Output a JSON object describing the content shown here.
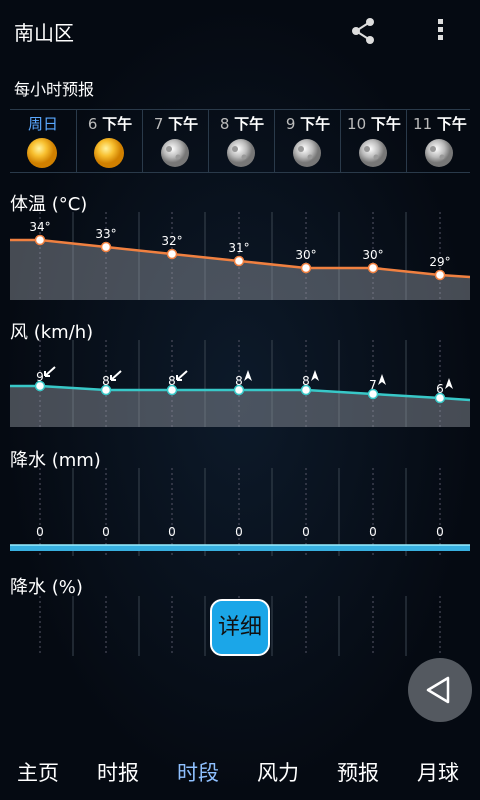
{
  "app": {
    "title": "南山区"
  },
  "icons": {
    "share": "share-icon",
    "more": "more-vert-icon",
    "back": "back-triangle-icon"
  },
  "hourly": {
    "heading": "每小时预报",
    "columns": [
      {
        "num": "",
        "suffix": "周日",
        "today": true,
        "icon": "sun-icon"
      },
      {
        "num": "6",
        "suffix": "下午",
        "today": false,
        "icon": "sun-icon"
      },
      {
        "num": "7",
        "suffix": "下午",
        "today": false,
        "icon": "moon-icon"
      },
      {
        "num": "8",
        "suffix": "下午",
        "today": false,
        "icon": "moon-icon"
      },
      {
        "num": "9",
        "suffix": "下午",
        "today": false,
        "icon": "moon-icon"
      },
      {
        "num": "10",
        "suffix": "下午",
        "today": false,
        "icon": "moon-icon"
      },
      {
        "num": "11",
        "suffix": "下午",
        "today": false,
        "icon": "moon-icon"
      }
    ]
  },
  "sections": {
    "temp": {
      "title": "体温 (°C)"
    },
    "wind": {
      "title": "风 (km/h)"
    },
    "precip_mm": {
      "title": "降水 (mm)"
    },
    "precip_pct": {
      "title": "降水 (%)"
    }
  },
  "chart_data": [
    {
      "type": "area",
      "name": "temp",
      "unit": "°",
      "values": [
        34,
        33,
        32,
        31,
        30,
        30,
        29
      ],
      "color": "#f08040"
    },
    {
      "type": "area",
      "name": "wind",
      "values": [
        9,
        8,
        8,
        8,
        8,
        7,
        6
      ],
      "color": "#38c8c8"
    },
    {
      "type": "area",
      "name": "precip_mm",
      "values": [
        0,
        0,
        0,
        0,
        0,
        0,
        0
      ],
      "color": "#38b0e0"
    }
  ],
  "detail_button": "详细",
  "nav": [
    {
      "label": "主页",
      "active": false
    },
    {
      "label": "时报",
      "active": false
    },
    {
      "label": "时段",
      "active": true
    },
    {
      "label": "风力",
      "active": false
    },
    {
      "label": "预报",
      "active": false
    },
    {
      "label": "月球",
      "active": false
    }
  ]
}
